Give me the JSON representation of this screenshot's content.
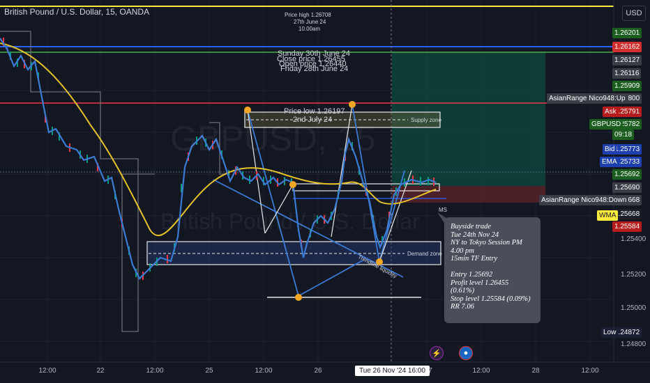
{
  "header": {
    "symbol_title": "British Pound / U.S. Dollar, 15, OANDA",
    "currency_button": "USD"
  },
  "watermark": {
    "symbol": "GBPUSD, 15",
    "name": "British Pound / U.S. Dollar"
  },
  "annotations": {
    "price_high": "Price high 1.26708",
    "price_high_date": "27th June 24",
    "price_high_time": "10.00am",
    "sunday": "Sunday 30th June 24",
    "close_price": "Close price 1.26455",
    "open_price": "Open price 1.26440",
    "friday": "Friday 28th June 24",
    "price_low": "Price low 1.26197",
    "price_low_date": "2nd July 24",
    "supply_zone": "Supply zone",
    "demand_zone": "Demand zone",
    "trendline_liquidity": "Trendline liquidity",
    "ms": "MS"
  },
  "note": {
    "lines": [
      "Buyside trade",
      "Tue 24th Nov 24",
      "NY to Tokyo Session PM",
      "4.00 pm",
      "15min TF Entry",
      "",
      "Entry 1.25692",
      "Profit level 1.26455 (0.61%)",
      "Stop level 1.25584 (0.09%)",
      "RR 7.06"
    ]
  },
  "price_axis": {
    "plain_labels": [
      "1.25400",
      "1.25200",
      "1.25000",
      "1.24800"
    ],
    "tags": [
      {
        "value": "1.26201",
        "color": "#1b5e20"
      },
      {
        "value": "1.26162",
        "color": "#d32f2f"
      },
      {
        "value": "1.26127",
        "color": "#3a3d46"
      },
      {
        "value": "1.26116",
        "color": "#3a3d46"
      },
      {
        "value": "1.25909",
        "color": "#1b5e20"
      },
      {
        "value": "1.25800",
        "color": "#3a3d46"
      },
      {
        "value": "1.25791",
        "color": "#b71c1c"
      },
      {
        "value": "1.25782",
        "color": "#1b5e20"
      },
      {
        "value": "09:18",
        "color": "#1b5e20"
      },
      {
        "value": "1.25773",
        "color": "#1e40af"
      },
      {
        "value": "1.25733",
        "color": "#1e40af"
      },
      {
        "value": "1.25692",
        "color": "#1b5e20"
      },
      {
        "value": "1.25690",
        "color": "#3a3d46"
      },
      {
        "value": "1.25668",
        "color": "#3a3d46"
      },
      {
        "value": "1.25668",
        "color": "#1b1e27"
      },
      {
        "value": "1.25584",
        "color": "#b71c1c"
      },
      {
        "value": "1.24872",
        "color": "#1a1f33"
      }
    ],
    "side_tags": {
      "asian_up": "AsianRange Nico948:Up",
      "ask": "Ask",
      "gbpusd": "GBPUSD",
      "bid": "Bid",
      "ema": "EMA",
      "asian_down": "AsianRange Nico948:Down",
      "wma": "WMA",
      "low": "Low"
    }
  },
  "time_axis": {
    "labels": [
      "12:00",
      "22",
      "12:00",
      "25",
      "12:00",
      "26",
      "7",
      "12:00",
      "28",
      "12:00"
    ],
    "cursor_label": "Tue 26 Nov '24   16:00"
  },
  "colors": {
    "background": "#131722",
    "yellow_line": "#ffeb3b",
    "blue_line": "#2962ff",
    "green_line": "#4caf50",
    "red_line": "#f23645",
    "price_line": "#3a7bd5",
    "ema_line": "#e6c229",
    "profit_zone": "#0e4b3f",
    "loss_zone": "#5a2429"
  }
}
